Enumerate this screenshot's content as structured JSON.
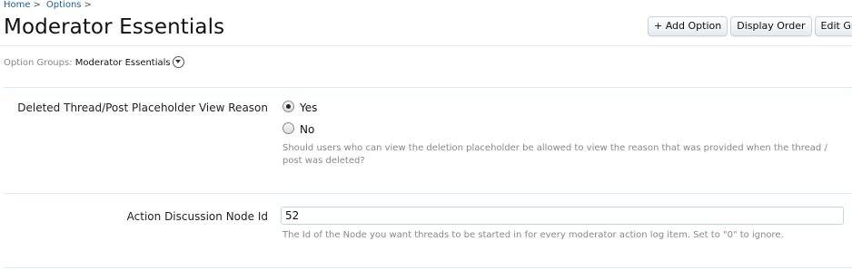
{
  "breadcrumb": [
    {
      "label": "Home",
      "sep": ">"
    },
    {
      "label": "Options",
      "sep": ">"
    }
  ],
  "page_title": "Moderator Essentials",
  "toolbar": {
    "add_option": "+ Add Option",
    "display_order": "Display Order",
    "edit_group_partial": "Edit Gro"
  },
  "option_groups": {
    "label": "Option Groups:",
    "value": "Moderator Essentials",
    "icon": "chevron-down-circle-icon"
  },
  "options": {
    "deleted_reason": {
      "label": "Deleted Thread/Post Placeholder View Reason",
      "choices": [
        {
          "label": "Yes",
          "selected": true
        },
        {
          "label": "No",
          "selected": false
        }
      ],
      "explain": "Should users who can view the deletion placeholder be allowed to view the reason that was provided when the thread / post was deleted?"
    },
    "discussion_node": {
      "label": "Action Discussion Node Id",
      "value": "52",
      "explain": "The Id of the Node you want threads to be started in for every moderator action log item. Set to \"0\" to ignore."
    }
  }
}
